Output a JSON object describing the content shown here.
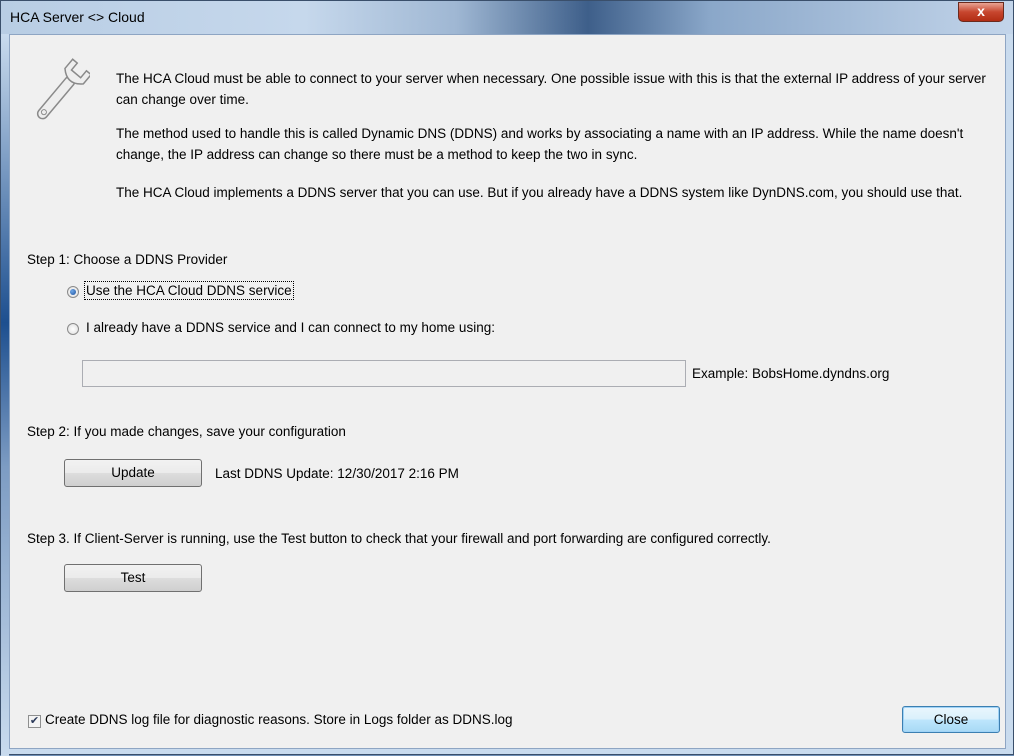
{
  "window": {
    "title": "HCA Server <> Cloud",
    "close_glyph": "x"
  },
  "intro": {
    "icon": "wrench-icon",
    "p1": "The HCA Cloud must be able to connect to your server when necessary. One possible issue with this is that the external IP address of your server can change over time.",
    "p2": "The method used to handle this is called Dynamic DNS (DDNS) and works by associating a name with an IP address. While the name doesn't change, the IP address can change so there must be a method to keep the two in sync.",
    "p3": "The HCA Cloud implements a DDNS server that you can use. But if you already have a DDNS system like DynDNS.com, you should use that."
  },
  "step1": {
    "label": "Step 1: Choose a DDNS Provider",
    "option_hca": "Use the HCA Cloud DDNS service",
    "option_own": "I already have a DDNS service and I can connect to my home using:",
    "selected": "option_hca",
    "host_value": "",
    "example": "Example: BobsHome.dyndns.org"
  },
  "step2": {
    "label": "Step 2: If you made changes, save your configuration",
    "update_button": "Update",
    "last_update": "Last DDNS Update: 12/30/2017 2:16 PM"
  },
  "step3": {
    "label": "Step 3. If Client-Server is running, use the Test button to check that your firewall and port forwarding are configured correctly.",
    "test_button": "Test"
  },
  "footer": {
    "log_checked": true,
    "log_label": "Create DDNS log file for diagnostic reasons. Store in Logs folder as DDNS.log",
    "close_button": "Close"
  }
}
